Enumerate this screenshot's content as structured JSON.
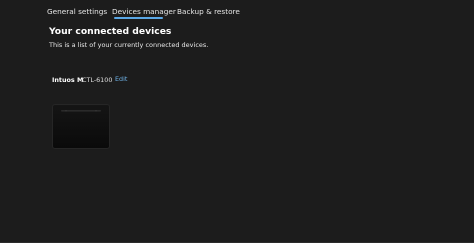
{
  "tabs": [
    {
      "label": "General settings",
      "active": false
    },
    {
      "label": "Devices manager",
      "active": true
    },
    {
      "label": "Backup & restore",
      "active": false
    }
  ],
  "main": {
    "heading": "Your connected devices",
    "subtext": "This is a list of your currently connected devices."
  },
  "device": {
    "name": "Intuos M",
    "model": "CTL-6100",
    "edit_label": "Edit",
    "image_icon": "tablet-image"
  },
  "colors": {
    "background": "#1c1c1c",
    "accent": "#5aa7e6",
    "link": "#6fb3e8",
    "tablet_body": "#0f0f0f"
  }
}
